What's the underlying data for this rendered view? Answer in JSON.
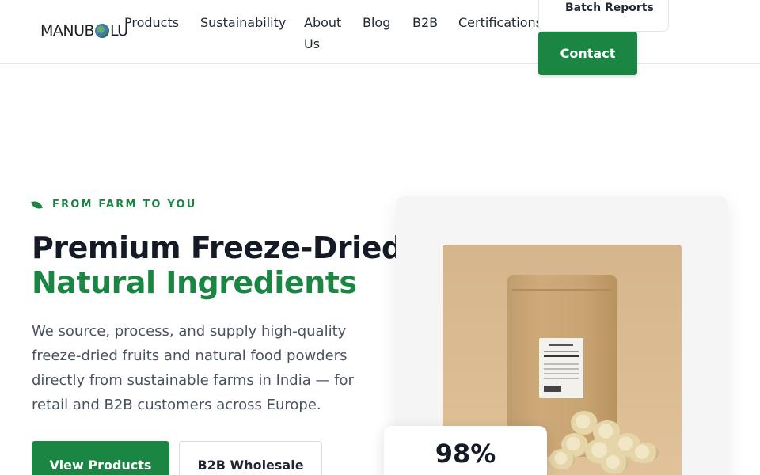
{
  "brand": {
    "name_left": "MANUB",
    "name_right": "LU"
  },
  "nav": {
    "items": [
      {
        "label": "Products"
      },
      {
        "label": "Sustainability"
      },
      {
        "label": "About Us"
      },
      {
        "label": "Blog"
      },
      {
        "label": "B2B"
      },
      {
        "label": "Certifications"
      }
    ],
    "batch_reports": "Batch Reports",
    "contact": "Contact"
  },
  "hero": {
    "eyebrow": "FROM FARM TO YOU",
    "title_line1": "Premium Freeze-Dried",
    "title_line2": "Natural Ingredients",
    "description": "We source, process, and supply high-quality freeze-dried fruits and natural food powders directly from sustainable farms in India — for retail and B2B customers across Europe.",
    "primary_cta": "View Products",
    "secondary_cta": "B2B Wholesale",
    "stat_value": "98%"
  },
  "colors": {
    "accent": "#1b8544",
    "heading": "#151b26",
    "body_text": "#4a5261"
  },
  "icons": {
    "eyebrow": "leaf-icon",
    "logo": "globe-icon"
  }
}
